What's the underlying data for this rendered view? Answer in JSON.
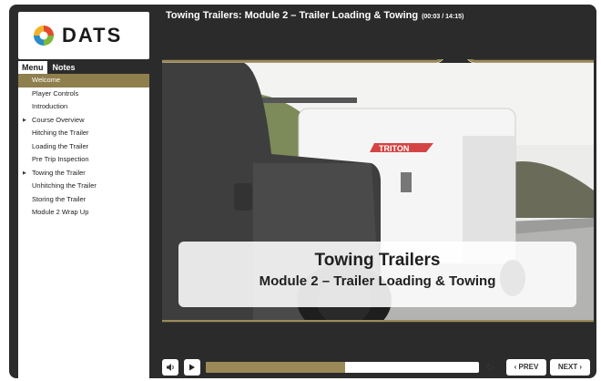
{
  "brand": {
    "logo_text": "DATS"
  },
  "header": {
    "title": "Towing Trailers: Module 2 – Trailer Loading & Towing",
    "time": "(00:03 / 14:15)"
  },
  "tabs": [
    {
      "label": "Menu",
      "active": true
    },
    {
      "label": "Notes",
      "active": false
    }
  ],
  "menu": {
    "items": [
      {
        "label": "Welcome",
        "selected": true,
        "expandable": false
      },
      {
        "label": "Player Controls",
        "selected": false,
        "expandable": false
      },
      {
        "label": "Introduction",
        "selected": false,
        "expandable": false
      },
      {
        "label": "Course Overview",
        "selected": false,
        "expandable": true
      },
      {
        "label": "Hitching the Trailer",
        "selected": false,
        "expandable": false
      },
      {
        "label": "Loading the Trailer",
        "selected": false,
        "expandable": false
      },
      {
        "label": "Pre Trip Inspection",
        "selected": false,
        "expandable": false
      },
      {
        "label": "Towing the Trailer",
        "selected": false,
        "expandable": true
      },
      {
        "label": "Unhitching the Trailer",
        "selected": false,
        "expandable": false
      },
      {
        "label": "Storing the Trailer",
        "selected": false,
        "expandable": false
      },
      {
        "label": "Module 2 Wrap Up",
        "selected": false,
        "expandable": false
      }
    ]
  },
  "slide": {
    "caption_title": "Towing Trailers",
    "caption_subtitle": "Module 2 – Trailer Loading & Towing",
    "trailer_brand": "TRITON"
  },
  "controls": {
    "volume_icon": "speaker-icon",
    "play_icon": "play-icon",
    "replay_icon": "replay-icon",
    "progress_fraction": 0.51,
    "prev_label": "‹ PREV",
    "next_label": "NEXT ›"
  },
  "colors": {
    "accent": "#9b8a58",
    "selected": "#8f7f4c",
    "frame": "#2b2b2b"
  }
}
